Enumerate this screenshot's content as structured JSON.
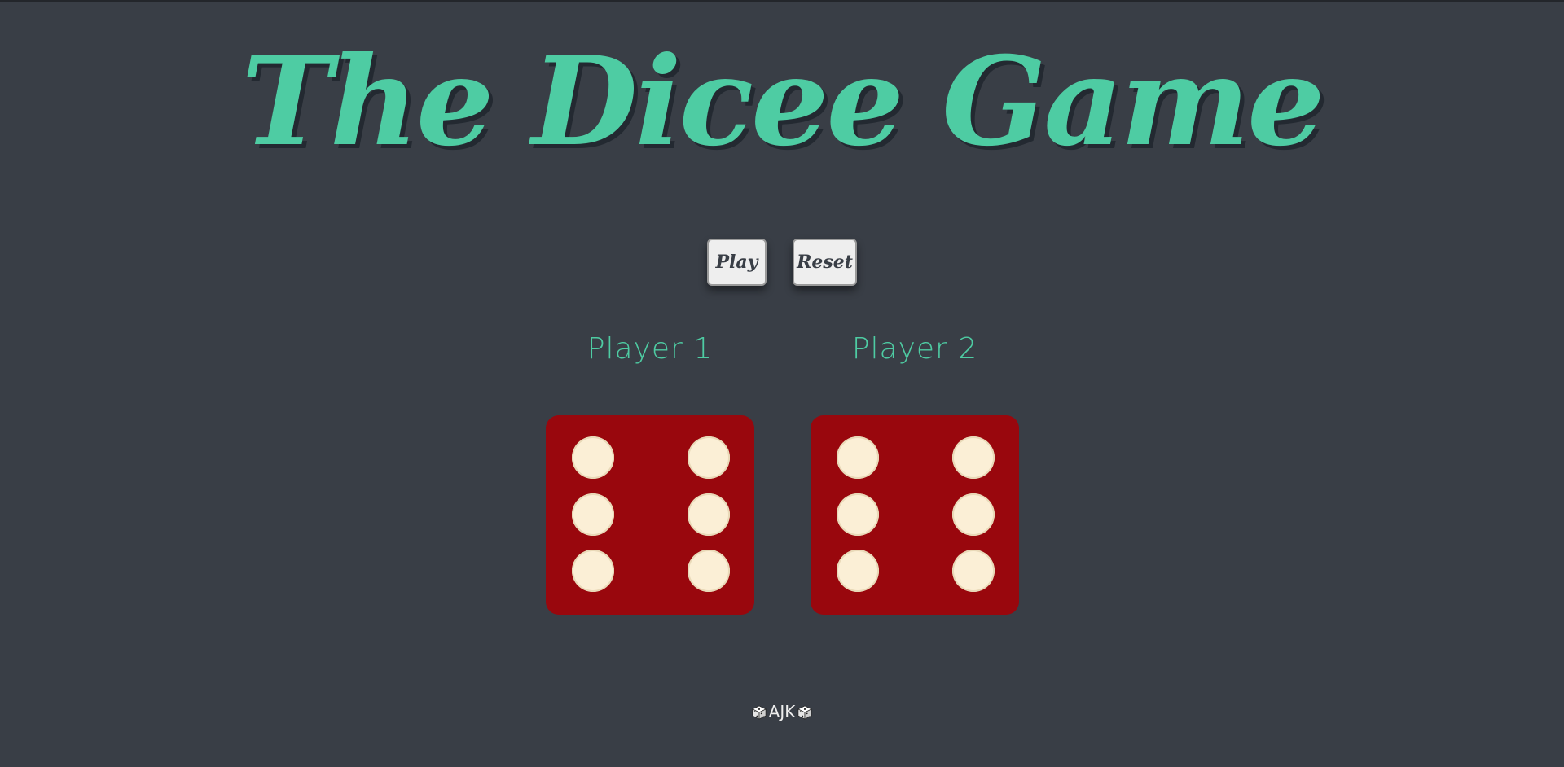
{
  "title": "The Dicee Game",
  "buttons": {
    "play_label": "Play",
    "reset_label": "Reset"
  },
  "players": [
    {
      "label": "Player 1",
      "die_value": 6
    },
    {
      "label": "Player 2",
      "die_value": 6
    }
  ],
  "footer": {
    "left_icon": "dice-icon",
    "text": "AJK",
    "right_icon": "dice-icon"
  },
  "colors": {
    "background": "#393E46",
    "accent": "#4ECCA3",
    "die": "#99070D",
    "pip": "#FBEFD6"
  }
}
